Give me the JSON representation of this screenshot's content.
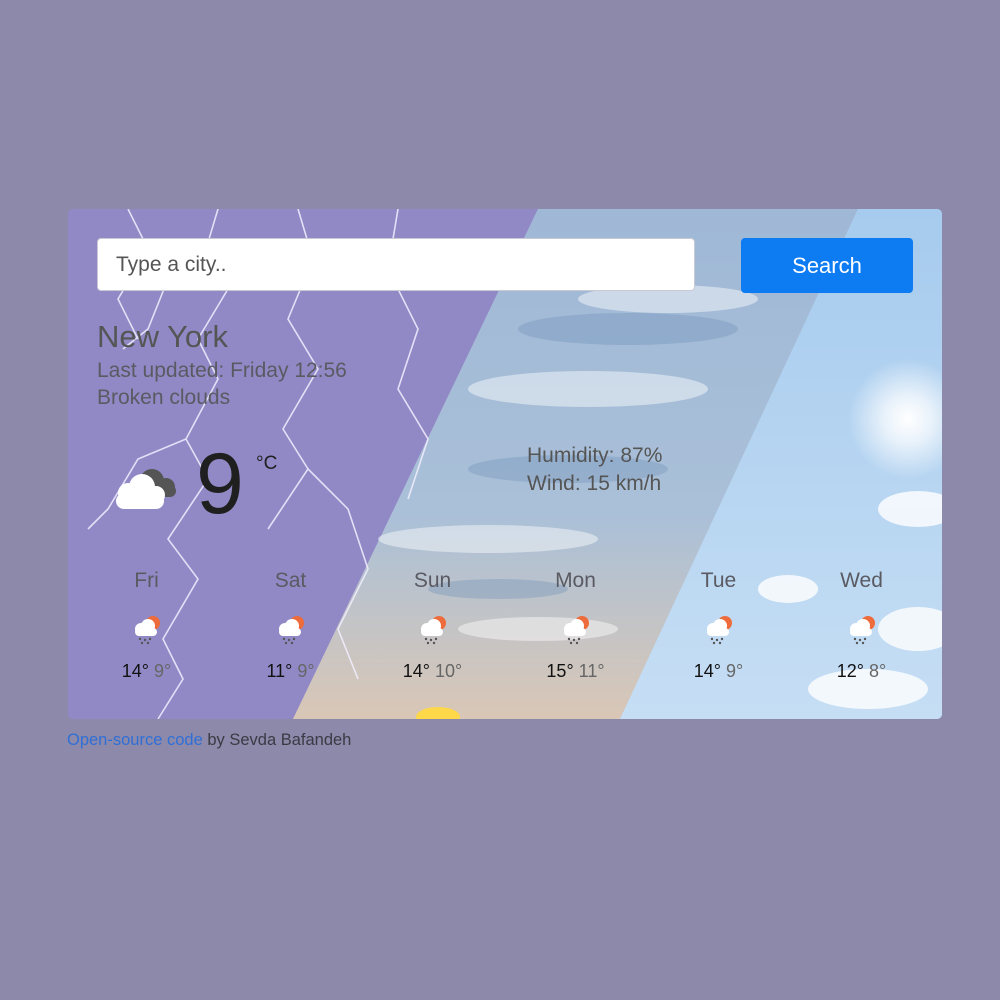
{
  "search": {
    "placeholder": "Type a city..",
    "button_label": "Search"
  },
  "current": {
    "city": "New York",
    "last_updated": "Last updated: Friday 12:56",
    "description": "Broken clouds",
    "temperature": "9",
    "unit": "°C",
    "icon": "broken-clouds-icon",
    "humidity": "Humidity: 87%",
    "wind": "Wind: 15 km/h"
  },
  "forecast": [
    {
      "day": "Fri",
      "max": "14°",
      "min": "9°",
      "icon": "rain-sun-icon"
    },
    {
      "day": "Sat",
      "max": "11°",
      "min": "9°",
      "icon": "rain-sun-icon"
    },
    {
      "day": "Sun",
      "max": "14°",
      "min": "10°",
      "icon": "rain-sun-icon"
    },
    {
      "day": "Mon",
      "max": "15°",
      "min": "11°",
      "icon": "rain-sun-icon"
    },
    {
      "day": "Tue",
      "max": "14°",
      "min": "9°",
      "icon": "rain-sun-icon"
    },
    {
      "day": "Wed",
      "max": "12°",
      "min": "8°",
      "icon": "rain-sun-icon"
    }
  ],
  "footer": {
    "link_text": "Open-source code",
    "suffix": " by Sevda Bafandeh"
  },
  "colors": {
    "page_background": "#8d89aa",
    "button": "#0d7cf2",
    "link": "#2f6fd6"
  }
}
